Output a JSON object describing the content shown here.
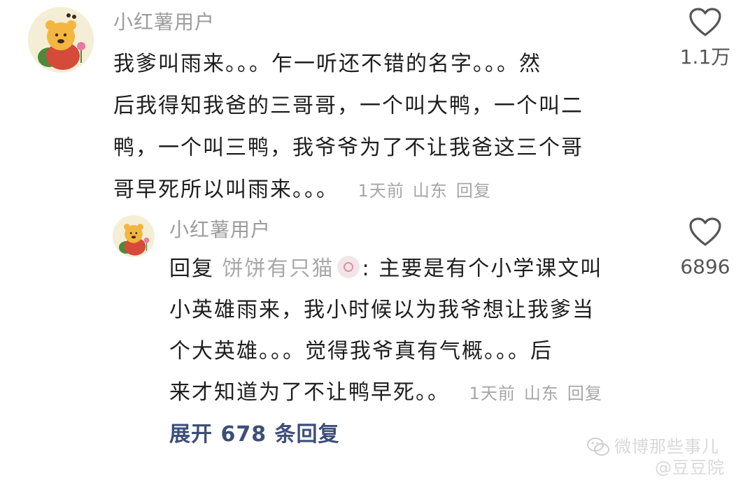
{
  "comments": [
    {
      "username": "小红薯用户",
      "lines": [
        "我爹叫雨来。。。乍一听还不错的名字。。。然",
        "后我得知我爸的三哥哥，一个叫大鸭，一个叫二",
        "鸭，一个叫三鸭，我爷爷为了不让我爸这三个哥",
        "哥早死所以叫雨来。。。"
      ],
      "time": "1天前",
      "location": "山东",
      "reply_label": "回复",
      "like_count": "1.1万"
    },
    {
      "username": "小红薯用户",
      "reply_prefix": "回复",
      "mention_name": "饼饼有只猫",
      "first_line_rest": ": 主要是有个小学课文叫",
      "lines": [
        "小英雄雨来，我小时候以为我爷想让我爹当",
        "个大英雄。。。觉得我爷真有气概。。。后",
        "来才知道为了不让鸭早死。。"
      ],
      "time": "1天前",
      "location": "山东",
      "reply_label": "回复",
      "like_count": "6896"
    }
  ],
  "expand_replies": "展开 678 条回复",
  "watermark": {
    "line1": "微博那些事儿",
    "line2": "@豆豆院"
  },
  "icons": {
    "like": "heart-outline-icon",
    "avatar": "pooh-bear-avatar",
    "watermark": "wechat-icon"
  },
  "colors": {
    "username": "#9c9c9c",
    "meta": "#a6a6a6",
    "expand_link": "#3c4f78"
  }
}
